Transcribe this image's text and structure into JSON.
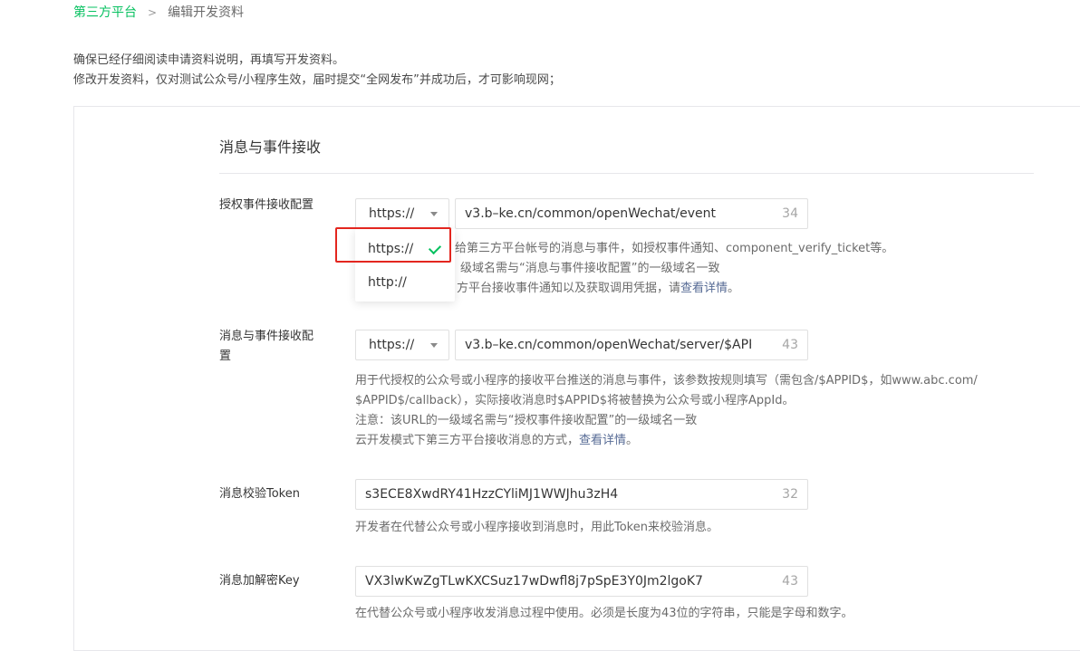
{
  "breadcrumb": {
    "parent": "第三方平台",
    "separator": ">",
    "current": "编辑开发资料"
  },
  "notice": {
    "line1": "确保已经仔细阅读申请资料说明，再填写开发资料。",
    "line2": "修改开发资料，仅对测试公众号/小程序生效，届时提交“全网发布”并成功后，才可影响现网；"
  },
  "section": {
    "title": "消息与事件接收"
  },
  "fields": {
    "auth_event": {
      "label": "授权事件接收配置",
      "protocol": "https://",
      "value": "v3.b–ke.cn/common/openWechat/event",
      "count": "34",
      "help1": "给第三方平台帐号的消息与事件，如授权事件通知、component_verify_ticket等。",
      "help2": "级域名需与“消息与事件接收配置”的一级域名一致",
      "help3": "方平台接收事件通知以及获取调用凭据，请",
      "help3_link": "查看详情",
      "help3_end": "。"
    },
    "msg_event": {
      "label_line1": "消息与事件接收配",
      "label_line2": "置",
      "protocol": "https://",
      "value": "v3.b–ke.cn/common/openWechat/server/$APPI",
      "count": "43",
      "help1": "用于代授权的公众号或小程序的接收平台推送的消息与事件，该参数按规则填写（需包含/$APPID$，如www.abc.com/",
      "help2": "$APPID$/callback），实际接收消息时$APPID$将被替换为公众号或小程序AppId。",
      "help3": "注意：该URL的一级域名需与“授权事件接收配置”的一级域名一致",
      "help4": "云开发模式下第三方平台接收消息的方式，",
      "help4_link": "查看详情",
      "help4_end": "。"
    },
    "token": {
      "label": "消息校验Token",
      "value": "s3ECE8XwdRY41HzzCYliMJ1WWJhu3zH4",
      "count": "32",
      "help": "开发者在代替公众号或小程序接收到消息时，用此Token来校验消息。"
    },
    "aes_key": {
      "label": "消息加解密Key",
      "value": "VX3lwKwZgTLwKXCSuz17wDwfl8j7pSpE3Y0Jm2lgoK7",
      "count": "43",
      "help": "在代替公众号或小程序收发消息过程中使用。必须是长度为43位的字符串，只能是字母和数字。"
    }
  },
  "dropdown": {
    "options": [
      {
        "label": "https://",
        "selected": true,
        "icon": "check-icon"
      },
      {
        "label": "http://",
        "selected": false
      }
    ]
  },
  "colors": {
    "accent": "#07c160",
    "link": "#576b95",
    "highlight": "#e3261f"
  }
}
